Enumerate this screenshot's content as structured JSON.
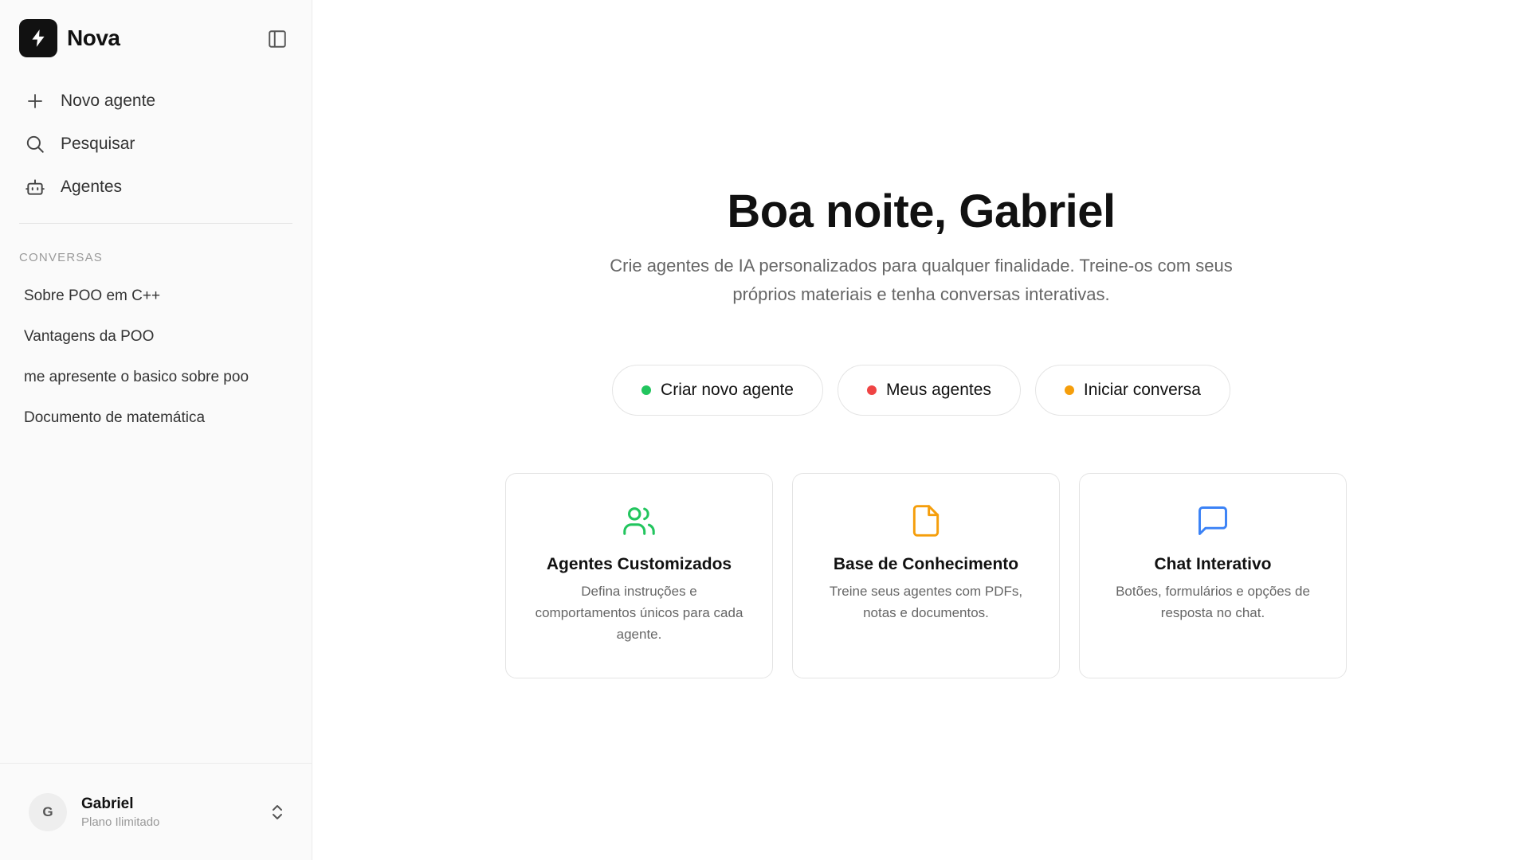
{
  "sidebar": {
    "brand": "Nova",
    "nav": [
      {
        "label": "Novo agente",
        "icon": "plus-icon"
      },
      {
        "label": "Pesquisar",
        "icon": "search-icon"
      },
      {
        "label": "Agentes",
        "icon": "bot-icon"
      }
    ],
    "section_label": "CONVERSAS",
    "conversations": [
      "Sobre POO em C++",
      "Vantagens da POO",
      "me apresente o basico sobre poo",
      "Documento de matemática"
    ],
    "user": {
      "initial": "G",
      "name": "Gabriel",
      "plan": "Plano Ilimitado"
    }
  },
  "main": {
    "greeting": "Boa noite, Gabriel",
    "subtitle": "Crie agentes de IA personalizados para qualquer finalidade. Treine-os com seus próprios materiais e tenha conversas interativas.",
    "actions": [
      {
        "label": "Criar novo agente",
        "color": "#22c55e"
      },
      {
        "label": "Meus agentes",
        "color": "#ef4444"
      },
      {
        "label": "Iniciar conversa",
        "color": "#f59e0b"
      }
    ],
    "cards": [
      {
        "title": "Agentes Customizados",
        "desc": "Defina instruções e comportamentos únicos para cada agente.",
        "icon": "users-icon",
        "color": "#22c55e"
      },
      {
        "title": "Base de Conhecimento",
        "desc": "Treine seus agentes com PDFs, notas e documentos.",
        "icon": "file-icon",
        "color": "#f59e0b"
      },
      {
        "title": "Chat Interativo",
        "desc": "Botões, formulários e opções de resposta no chat.",
        "icon": "message-icon",
        "color": "#3b82f6"
      }
    ]
  }
}
